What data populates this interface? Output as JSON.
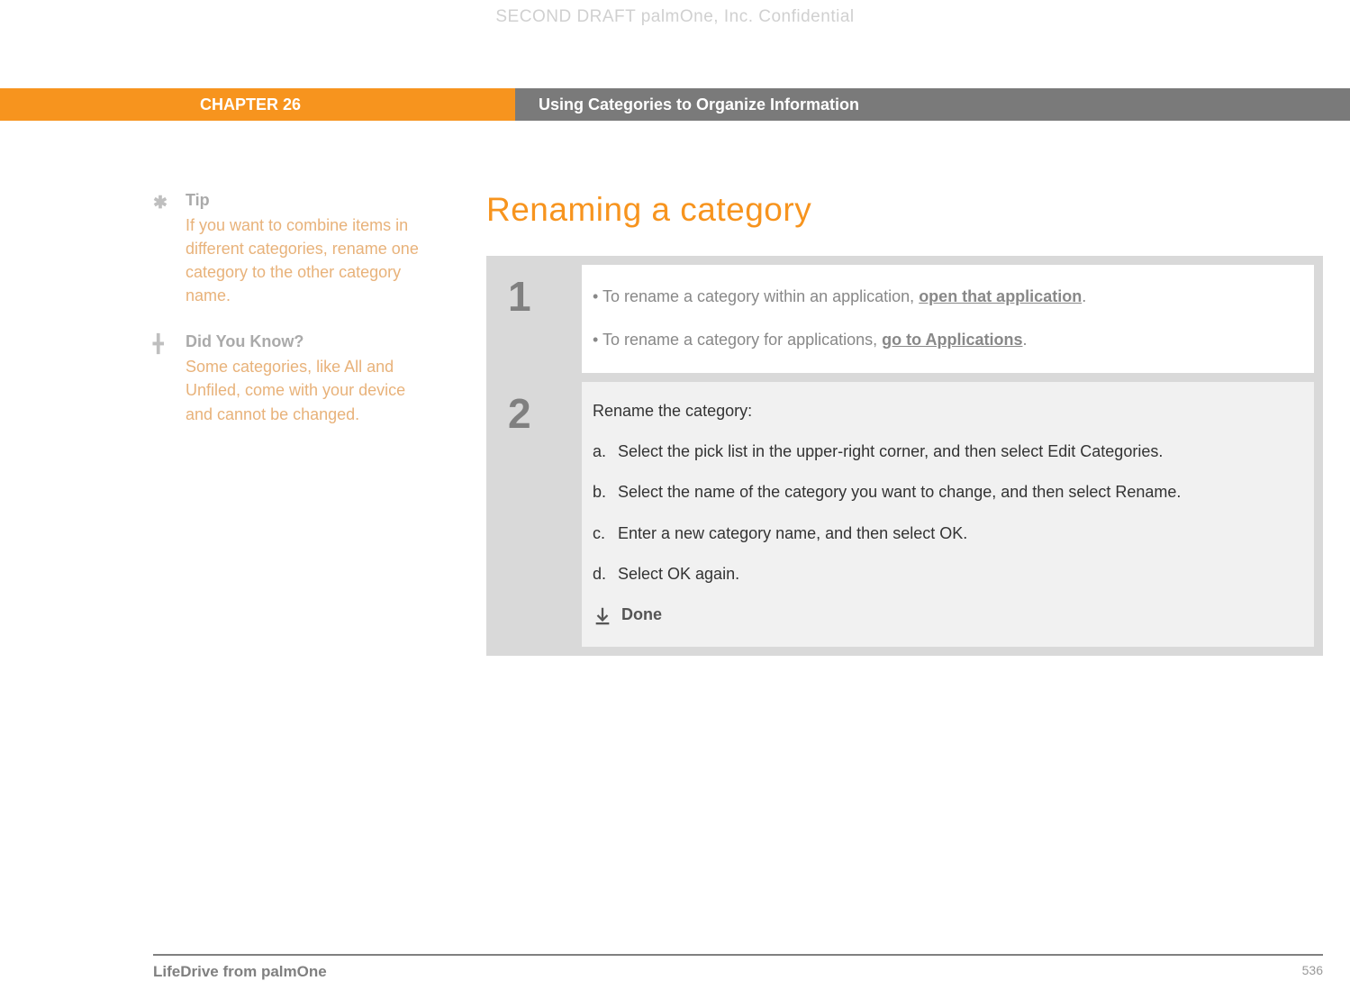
{
  "watermark": "SECOND DRAFT palmOne, Inc.  Confidential",
  "header": {
    "chapter": "CHAPTER 26",
    "title": "Using Categories to Organize Information"
  },
  "sidebar": {
    "tip": {
      "heading": "Tip",
      "body": "If you want to combine items in different categories, rename one category to the other category name."
    },
    "didyouknow": {
      "heading": "Did You Know?",
      "body": "Some categories, like All and Unfiled, come with your device and cannot be changed."
    }
  },
  "main": {
    "title": "Renaming a category",
    "step1": {
      "num": "1",
      "line1_prefix": "• To rename a category within an application, ",
      "line1_link": "open that application",
      "line1_suffix": ".",
      "line2_prefix": "• To rename a category for applications, ",
      "line2_link": "go to Applications",
      "line2_suffix": "."
    },
    "step2": {
      "num": "2",
      "intro": "Rename the category:",
      "a_letter": "a.",
      "a_text": "Select the pick list in the upper-right corner, and then select Edit Categories.",
      "b_letter": "b.",
      "b_text": "Select the name of the category you want to change, and then select Rename.",
      "c_letter": "c.",
      "c_text": "Enter a new category name, and then select OK.",
      "d_letter": "d.",
      "d_text": "Select OK again.",
      "done": "Done"
    }
  },
  "footer": {
    "product": "LifeDrive from palmOne",
    "page": "536"
  }
}
